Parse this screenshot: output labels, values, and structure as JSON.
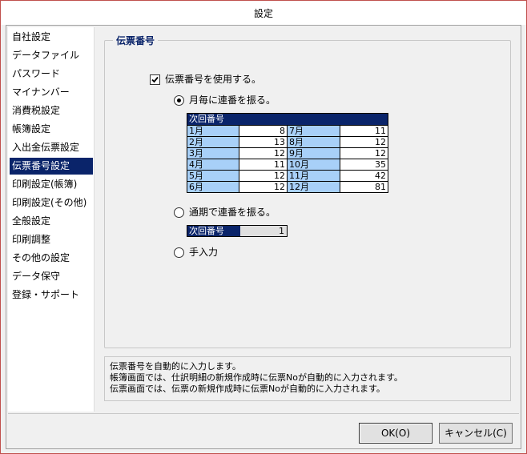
{
  "window": {
    "title": "設定"
  },
  "sidebar": {
    "items": [
      {
        "label": "自社設定"
      },
      {
        "label": "データファイル"
      },
      {
        "label": "パスワード"
      },
      {
        "label": "マイナンバー"
      },
      {
        "label": "消費税設定"
      },
      {
        "label": "帳簿設定"
      },
      {
        "label": "入出金伝票設定"
      },
      {
        "label": "伝票番号設定"
      },
      {
        "label": "印刷設定(帳簿)"
      },
      {
        "label": "印刷設定(その他)"
      },
      {
        "label": "全般設定"
      },
      {
        "label": "印刷調整"
      },
      {
        "label": "その他の設定"
      },
      {
        "label": "データ保守"
      },
      {
        "label": "登録・サポート"
      }
    ],
    "selected_index": 7
  },
  "group": {
    "title": "伝票番号"
  },
  "use_number": {
    "label": "伝票番号を使用する。",
    "checked": true
  },
  "monthly": {
    "label": "月毎に連番を振る。",
    "selected": true,
    "grid_header": "次回番号",
    "rows": [
      {
        "m1": "1月",
        "v1": "8",
        "m2": "7月",
        "v2": "11"
      },
      {
        "m1": "2月",
        "v1": "13",
        "m2": "8月",
        "v2": "12"
      },
      {
        "m1": "3月",
        "v1": "12",
        "m2": "9月",
        "v2": "12"
      },
      {
        "m1": "4月",
        "v1": "11",
        "m2": "10月",
        "v2": "35"
      },
      {
        "m1": "5月",
        "v1": "12",
        "m2": "11月",
        "v2": "42"
      },
      {
        "m1": "6月",
        "v1": "12",
        "m2": "12月",
        "v2": "81"
      }
    ]
  },
  "yearly": {
    "label": "通期で連番を振る。",
    "selected": false,
    "next_label": "次回番号",
    "next_value": "1"
  },
  "manual": {
    "label": "手入力",
    "selected": false
  },
  "description": {
    "lines": [
      "伝票番号を自動的に入力します。",
      "帳簿画面では、仕訳明細の新規作成時に伝票Noが自動的に入力されます。",
      "伝票画面では、伝票の新規作成時に伝票Noが自動的に入力されます。"
    ]
  },
  "buttons": {
    "ok": "OK(O)",
    "cancel": "キャンセル(C)"
  }
}
